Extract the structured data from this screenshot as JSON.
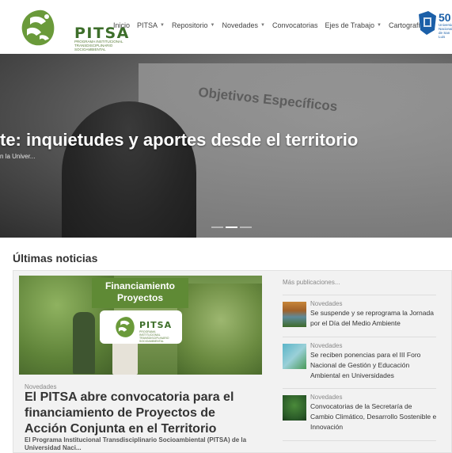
{
  "header": {
    "logo_text": "PITSA",
    "logo_subtitle": "PROGRAMA INSTITUCIONAL TRANSDISCIPLINARIO SOCIOAMBIENTAL",
    "nav": [
      {
        "label": "Inicio",
        "dropdown": false
      },
      {
        "label": "PITSA",
        "dropdown": true
      },
      {
        "label": "Repositorio",
        "dropdown": true
      },
      {
        "label": "Novedades",
        "dropdown": true
      },
      {
        "label": "Convocatorias",
        "dropdown": false
      },
      {
        "label": "Ejes de Trabajo",
        "dropdown": true
      },
      {
        "label": "Cartografía",
        "dropdown": false
      }
    ],
    "university_logo": {
      "number": "50",
      "text": "Universidad Nacional de San Luis"
    }
  },
  "hero": {
    "title": "te: inquietudes y aportes desde el territorio",
    "subtitle": "n la Univer...",
    "slide_text": "Objetivos Específicos",
    "slides_count": 3,
    "active_slide": 2
  },
  "section": {
    "title": "Últimas noticias"
  },
  "featured": {
    "image_banner": "Financiamiento Proyectos",
    "badge_text": "PITSA",
    "badge_subtitle": "PROGRAMA INSTITUCIONAL TRANSDISCIPLINARIO SOCIOAMBIENTAL",
    "category": "Novedades",
    "title": "El PITSA abre convocatoria para el financiamiento de Proyectos de Acción Conjunta en el Territorio",
    "excerpt": "El Programa Institucional Transdisciplinario Socioambiental (PITSA) de la Universidad Naci..."
  },
  "sidebar": {
    "more_label": "Más publicaciones...",
    "items": [
      {
        "category": "Novedades",
        "title": "Se suspende y se reprograma la Jornada por el Día del Medio Ambiente"
      },
      {
        "category": "Novedades",
        "title": "Se reciben ponencias para el III Foro Nacional de Gestión y Educación Ambiental en Universidades"
      },
      {
        "category": "Novedades",
        "title": "Convocatorias de la Secretaría de Cambio Climático, Desarrollo Sostenible e Innovación"
      }
    ]
  },
  "colors": {
    "brand_green": "#3d6e2a",
    "banner_green": "#5f8a35",
    "uni_blue": "#1b5fa8"
  }
}
